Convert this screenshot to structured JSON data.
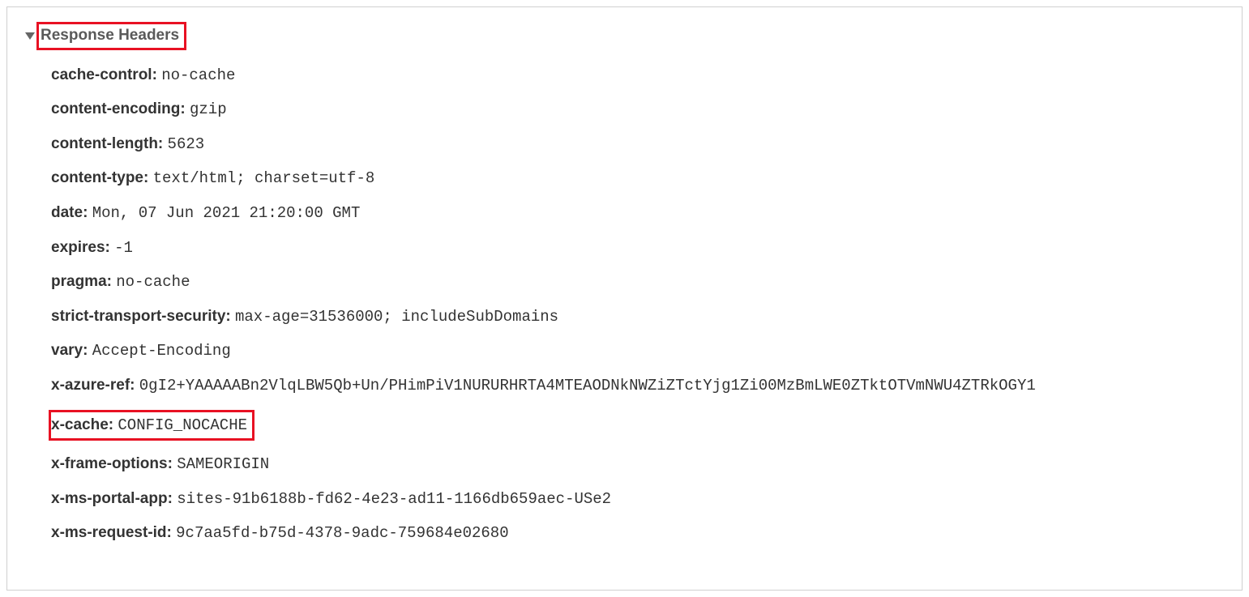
{
  "section": {
    "title": "Response Headers"
  },
  "headers": [
    {
      "name": "cache-control:",
      "value": "no-cache",
      "highlight": false
    },
    {
      "name": "content-encoding:",
      "value": "gzip",
      "highlight": false
    },
    {
      "name": "content-length:",
      "value": "5623",
      "highlight": false
    },
    {
      "name": "content-type:",
      "value": "text/html; charset=utf-8",
      "highlight": false
    },
    {
      "name": "date:",
      "value": "Mon, 07 Jun 2021 21:20:00 GMT",
      "highlight": false
    },
    {
      "name": "expires:",
      "value": "-1",
      "highlight": false
    },
    {
      "name": "pragma:",
      "value": "no-cache",
      "highlight": false
    },
    {
      "name": "strict-transport-security:",
      "value": "max-age=31536000; includeSubDomains",
      "highlight": false
    },
    {
      "name": "vary:",
      "value": "Accept-Encoding",
      "highlight": false
    },
    {
      "name": "x-azure-ref:",
      "value": "0gI2+YAAAAABn2VlqLBW5Qb+Un/PHimPiV1NURURHRTA4MTEAODNkNWZiZTctYjg1Zi00MzBmLWE0ZTktOTVmNWU4ZTRkOGY1",
      "highlight": false
    },
    {
      "name": "x-cache:",
      "value": "CONFIG_NOCACHE",
      "highlight": true
    },
    {
      "name": "x-frame-options:",
      "value": "SAMEORIGIN",
      "highlight": false
    },
    {
      "name": "x-ms-portal-app:",
      "value": "sites-91b6188b-fd62-4e23-ad11-1166db659aec-USe2",
      "highlight": false
    },
    {
      "name": "x-ms-request-id:",
      "value": "9c7aa5fd-b75d-4378-9adc-759684e02680",
      "highlight": false
    }
  ]
}
